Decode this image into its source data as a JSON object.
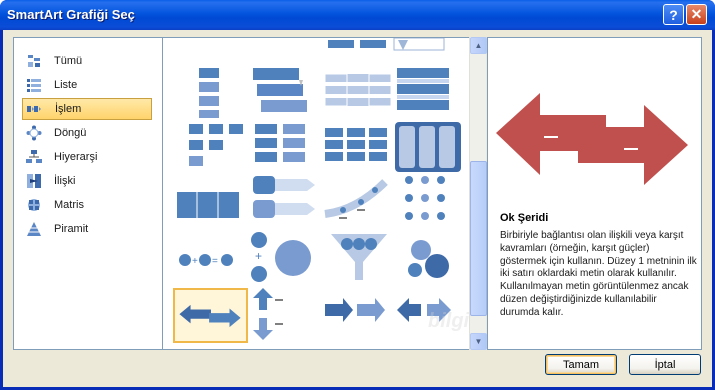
{
  "window": {
    "title": "SmartArt Grafiği Seç",
    "help_label": "?",
    "close_label": "✕"
  },
  "categories": [
    {
      "label": "Tümü",
      "icon": "all-icon"
    },
    {
      "label": "Liste",
      "icon": "list-icon"
    },
    {
      "label": "İşlem",
      "icon": "process-icon",
      "selected": true
    },
    {
      "label": "Döngü",
      "icon": "cycle-icon"
    },
    {
      "label": "Hiyerarşi",
      "icon": "hierarchy-icon"
    },
    {
      "label": "İlişki",
      "icon": "relationship-icon"
    },
    {
      "label": "Matris",
      "icon": "matrix-icon"
    },
    {
      "label": "Piramit",
      "icon": "pyramid-icon"
    }
  ],
  "gallery": {
    "selected_index": 16
  },
  "preview": {
    "title": "Ok Şeridi",
    "description": "Birbiriyle bağlantısı olan ilişkili veya karşıt kavramları (örneğin, karşıt güçler) göstermek için kullanın. Düzey 1 metninin ilk iki satırı oklardaki metin olarak kullanılır. Kullanılmayan metin görüntülenmez ancak düzen değiştirdiğinizde kullanılabilir durumda kalır."
  },
  "buttons": {
    "ok_label": "Tamam",
    "cancel_label": "İptal"
  },
  "colors": {
    "accent_blue": "#4f81bd",
    "arrow_red": "#c0504d",
    "selection": "#f0b848"
  }
}
